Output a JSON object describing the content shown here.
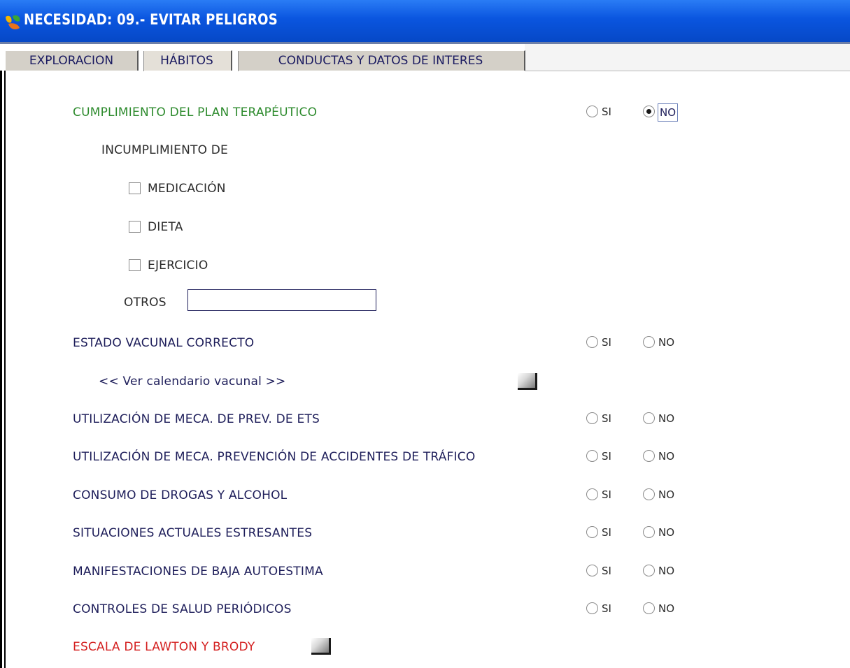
{
  "window": {
    "title": "NECESIDAD: 09.- EVITAR PELIGROS",
    "icon": "app-logo-icon"
  },
  "tabs": [
    {
      "label": "EXPLORACION",
      "active": false
    },
    {
      "label": "HÁBITOS",
      "active": true
    },
    {
      "label": "CONDUCTAS Y DATOS DE INTERES",
      "active": false
    }
  ],
  "plan": {
    "label": "CUMPLIMIENTO DEL PLAN TERAPÉUTICO",
    "si": "SI",
    "no": "NO",
    "selected": "NO",
    "incumplimiento_label": "INCUMPLIMIENTO DE",
    "checks": [
      {
        "label": "MEDICACIÓN",
        "checked": false
      },
      {
        "label": "DIETA",
        "checked": false
      },
      {
        "label": "EJERCICIO",
        "checked": false
      }
    ],
    "otros_label": "OTROS",
    "otros_value": ""
  },
  "vacunal": {
    "label": "ESTADO VACUNAL CORRECTO",
    "si": "SI",
    "no": "NO",
    "calendar_link": "<< Ver calendario vacunal >>"
  },
  "questions": [
    {
      "label": "UTILIZACIÓN DE MECA. DE PREV. DE ETS",
      "si": "SI",
      "no": "NO"
    },
    {
      "label": "UTILIZACIÓN DE MECA. PREVENCIÓN DE ACCIDENTES DE TRÁFICO",
      "si": "SI",
      "no": "NO"
    },
    {
      "label": "CONSUMO DE DROGAS Y ALCOHOL",
      "si": "SI",
      "no": "NO"
    },
    {
      "label": "SITUACIONES ACTUALES ESTRESANTES",
      "si": "SI",
      "no": "NO"
    },
    {
      "label": "MANIFESTACIONES DE BAJA AUTOESTIMA",
      "si": "SI",
      "no": "NO"
    },
    {
      "label": "CONTROLES DE SALUD PERIÓDICOS",
      "si": "SI",
      "no": "NO"
    }
  ],
  "escala": {
    "label": "ESCALA DE LAWTON Y BRODY"
  },
  "colors": {
    "titlebar": "#0a55df",
    "label_green": "#2e8b2e",
    "label_red": "#d42020",
    "label_navy": "#1e1e5a"
  }
}
